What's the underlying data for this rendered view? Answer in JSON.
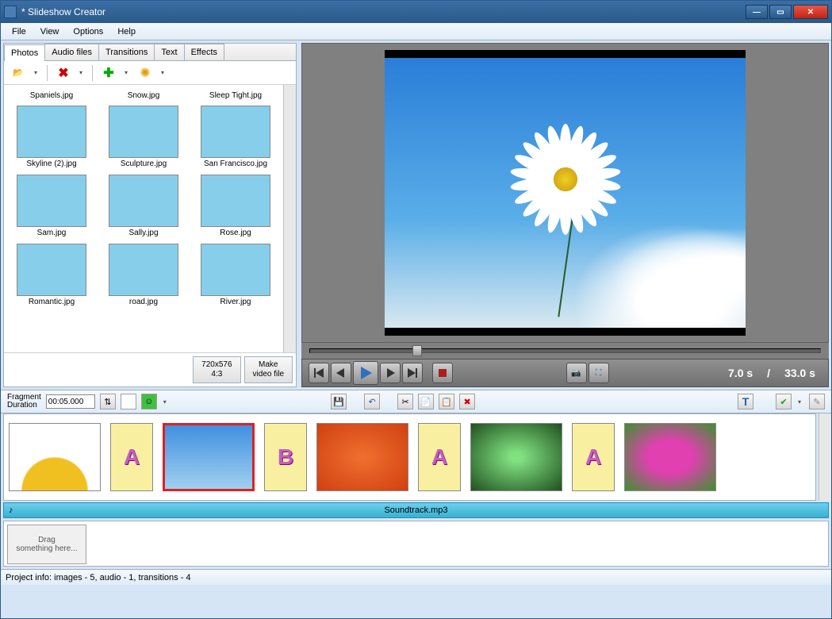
{
  "window": {
    "title": "* Slideshow Creator"
  },
  "menu": [
    "File",
    "View",
    "Options",
    "Help"
  ],
  "tabs": [
    "Photos",
    "Audio files",
    "Transitions",
    "Text",
    "Effects"
  ],
  "active_tab": 0,
  "thumbnails_partial_row": [
    "Spaniels.jpg",
    "Snow.jpg",
    "Sleep Tight.jpg"
  ],
  "thumbnails": [
    {
      "label": "Skyline (2).jpg",
      "cls": "th-sky"
    },
    {
      "label": "Sculpture.jpg",
      "cls": "th-sculp"
    },
    {
      "label": "San Francisco.jpg",
      "cls": "th-sf"
    },
    {
      "label": "Sam.jpg",
      "cls": "th-sam"
    },
    {
      "label": "Sally.jpg",
      "cls": "th-sally"
    },
    {
      "label": "Rose.jpg",
      "cls": "th-rose"
    },
    {
      "label": "Romantic.jpg",
      "cls": "th-rom"
    },
    {
      "label": "road.jpg",
      "cls": "th-road"
    },
    {
      "label": "River.jpg",
      "cls": "th-river"
    }
  ],
  "footer_buttons": {
    "resolution": "720x576\n4:3",
    "make": "Make\nvideo file"
  },
  "playback": {
    "current": "7.0 s",
    "sep": "/",
    "total": "33.0 s"
  },
  "fragment": {
    "label": "Fragment\nDuration",
    "value": "00:05.000"
  },
  "timeline": [
    {
      "type": "photo",
      "cls": "th-yellow",
      "selected": false
    },
    {
      "type": "trans",
      "letter": "A"
    },
    {
      "type": "photo",
      "cls": "th-daisy",
      "selected": true
    },
    {
      "type": "trans",
      "letter": "B"
    },
    {
      "type": "photo",
      "cls": "th-rose",
      "selected": false
    },
    {
      "type": "trans",
      "letter": "A"
    },
    {
      "type": "photo",
      "cls": "th-green",
      "selected": false
    },
    {
      "type": "trans",
      "letter": "A"
    },
    {
      "type": "photo",
      "cls": "th-pink",
      "selected": false
    }
  ],
  "audio_track": "Soundtrack.mp3",
  "dropzone": "Drag\nsomething here...",
  "status": "Project info: images - 5, audio - 1, transitions - 4"
}
